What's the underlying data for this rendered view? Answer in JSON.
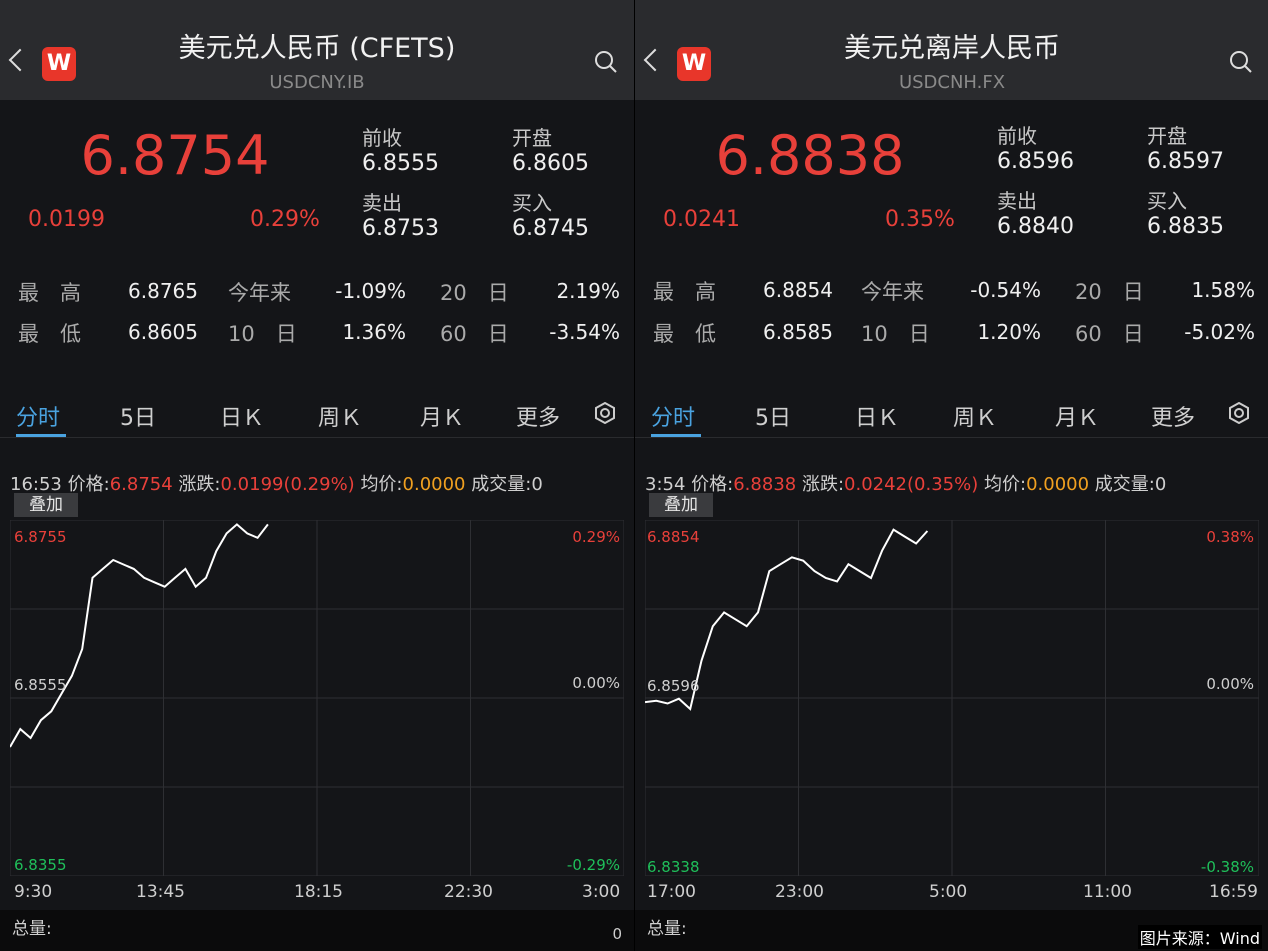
{
  "left": {
    "title": "美元兑人民币 (CFETS)",
    "code": "USDCNY.IB",
    "logo": "W",
    "price": "6.8754",
    "change": "0.0199",
    "change_pct": "0.29%",
    "quote": {
      "prev_label": "前收",
      "prev": "6.8555",
      "open_label": "开盘",
      "open": "6.8605",
      "ask_label": "卖出",
      "ask": "6.8753",
      "bid_label": "买入",
      "bid": "6.8745"
    },
    "stats": [
      {
        "label": "最　高",
        "value": "6.8765",
        "l2": "今年来",
        "v2": "-1.09%",
        "l3": "20　日",
        "v3": "2.19%"
      },
      {
        "label": "最　低",
        "value": "6.8605",
        "l2": "10　日",
        "v2": "1.36%",
        "l3": "60　日",
        "v3": "-3.54%"
      }
    ],
    "tabs": [
      "分时",
      "5日",
      "日Ｋ",
      "周Ｋ",
      "月Ｋ",
      "更多"
    ],
    "info": {
      "time": "16:53",
      "price_label": "价格:",
      "price": "6.8754",
      "chg_label": "涨跌:",
      "chg": "0.0199(0.29%)",
      "avg_label": "均价:",
      "avg": "0.0000",
      "vol_label": "成交量:",
      "vol": "0"
    },
    "overlay": "叠加",
    "y_top": "6.8755",
    "y_mid": "6.8555",
    "y_bot": "6.8355",
    "p_top": "0.29%",
    "p_mid": "0.00%",
    "p_bot": "-0.29%",
    "x_labels": [
      "9:30",
      "13:45",
      "18:15",
      "22:30",
      "3:00"
    ],
    "volume_label": "总量:",
    "volume_value": "0"
  },
  "right": {
    "title": "美元兑离岸人民币",
    "code": "USDCNH.FX",
    "logo": "W",
    "price": "6.8838",
    "change": "0.0241",
    "change_pct": "0.35%",
    "quote": {
      "prev_label": "前收",
      "prev": "6.8596",
      "open_label": "开盘",
      "open": "6.8597",
      "ask_label": "卖出",
      "ask": "6.8840",
      "bid_label": "买入",
      "bid": "6.8835"
    },
    "stats": [
      {
        "label": "最　高",
        "value": "6.8854",
        "l2": "今年来",
        "v2": "-0.54%",
        "l3": "20　日",
        "v3": "1.58%"
      },
      {
        "label": "最　低",
        "value": "6.8585",
        "l2": "10　日",
        "v2": "1.20%",
        "l3": "60　日",
        "v3": "-5.02%"
      }
    ],
    "tabs": [
      "分时",
      "5日",
      "日Ｋ",
      "周Ｋ",
      "月Ｋ",
      "更多"
    ],
    "info": {
      "time": "3:54",
      "price_label": "价格:",
      "price": "6.8838",
      "chg_label": "涨跌:",
      "chg": "0.0242(0.35%)",
      "avg_label": "均价:",
      "avg": "0.0000",
      "vol_label": "成交量:",
      "vol": "0"
    },
    "overlay": "叠加",
    "y_top": "6.8854",
    "y_mid": "6.8596",
    "y_bot": "6.8338",
    "p_top": "0.38%",
    "p_mid": "0.00%",
    "p_bot": "-0.38%",
    "x_labels": [
      "17:00",
      "23:00",
      "5:00",
      "11:00",
      "16:59"
    ],
    "volume_label": "总量:",
    "volume_value": ""
  },
  "source_caption": "图片来源：Wind",
  "colors": {
    "up": "#e8403a",
    "down": "#1fbf5a",
    "accent": "#4aa3e0",
    "avg": "#f0a020",
    "bg": "#141518",
    "header": "#2a2b2e"
  },
  "chart_data": [
    {
      "type": "line",
      "series": [
        {
          "values": [
            6.85,
            6.852,
            6.851,
            6.853,
            6.854,
            6.856,
            6.858,
            6.861,
            6.869,
            6.87,
            6.871,
            6.8705,
            6.87,
            6.869,
            6.8685,
            6.868,
            6.869,
            6.87,
            6.868,
            6.869,
            6.872,
            6.874,
            6.875,
            6.874,
            6.8735,
            6.875
          ]
        }
      ],
      "ylim": [
        6.8355,
        6.8755
      ],
      "x_ticks": [
        "9:30",
        "13:45",
        "18:15",
        "22:30",
        "3:00"
      ]
    },
    {
      "type": "line",
      "series": [
        {
          "values": [
            6.859,
            6.8592,
            6.8588,
            6.8595,
            6.858,
            6.865,
            6.87,
            6.872,
            6.871,
            6.87,
            6.872,
            6.878,
            6.879,
            6.88,
            6.8795,
            6.878,
            6.877,
            6.8765,
            6.879,
            6.878,
            6.877,
            6.881,
            6.884,
            6.883,
            6.882,
            6.8838
          ]
        }
      ],
      "ylim": [
        6.8338,
        6.8854
      ],
      "x_ticks": [
        "17:00",
        "23:00",
        "5:00",
        "11:00",
        "16:59"
      ]
    }
  ]
}
